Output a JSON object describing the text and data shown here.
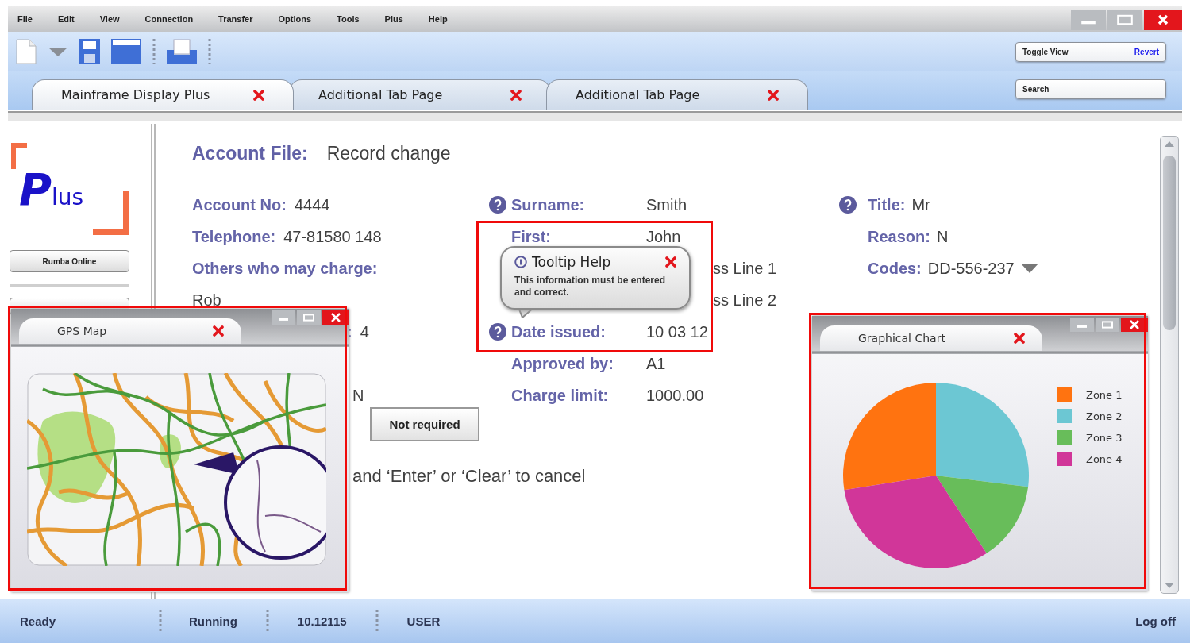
{
  "menu": [
    "File",
    "Edit",
    "View",
    "Connection",
    "Transfer",
    "Options",
    "Tools",
    "Plus",
    "Help"
  ],
  "toolbar": {
    "toggle_label": "Toggle View",
    "revert_link": "Revert",
    "search_label": "Search"
  },
  "tabs": [
    {
      "label": "Mainframe Display Plus",
      "selected": true
    },
    {
      "label": "Additional Tab Page",
      "selected": false
    },
    {
      "label": "Additional Tab Page",
      "selected": false
    }
  ],
  "sidebar": {
    "logo": "Plus",
    "buttons": [
      "Rumba Online"
    ]
  },
  "form": {
    "title_label": "Account File:",
    "title_value": "Record change",
    "columns": [
      [
        {
          "kind": "field",
          "help": false,
          "label": "Account No:",
          "value": "4444"
        },
        {
          "kind": "field",
          "help": false,
          "label": "Telephone:",
          "value": "47-81580 148"
        },
        {
          "kind": "heading",
          "help": false,
          "label": "Others who may charge:"
        },
        {
          "kind": "text",
          "help": false,
          "value": "Rob"
        },
        {
          "kind": "covered",
          "help": false,
          "label": ":",
          "value": "4"
        },
        {
          "kind": "choice",
          "help": false,
          "value": "N"
        }
      ],
      [
        {
          "kind": "field",
          "help": true,
          "label": "Surname:",
          "value": "Smith"
        },
        {
          "kind": "field",
          "help": false,
          "label": "First:",
          "value": "John"
        },
        {
          "kind": "covered",
          "help": false,
          "value": "ss Line 1"
        },
        {
          "kind": "covered",
          "help": false,
          "value": "ss Line 2"
        },
        {
          "kind": "field",
          "help": true,
          "label": "Date issued:",
          "value": "10 03 12"
        },
        {
          "kind": "field",
          "help": false,
          "label": "Approved by:",
          "value": "A1"
        },
        {
          "kind": "field",
          "help": false,
          "label": "Charge limit:",
          "value": "1000.00"
        }
      ],
      [
        {
          "kind": "inline",
          "help": true,
          "dropdown": false,
          "label": "Title:",
          "value": "Mr"
        },
        {
          "kind": "inline",
          "help": false,
          "dropdown": false,
          "label": "Reason:",
          "value": "N"
        },
        {
          "kind": "inline",
          "help": false,
          "dropdown": true,
          "label": "Codes:",
          "value": "DD-556-237"
        }
      ]
    ],
    "option_button": "Not required",
    "instruction": "and ‘Enter’ or ‘Clear’ to cancel"
  },
  "tooltip": {
    "title": "Tooltip Help",
    "text": "This information must be entered and correct."
  },
  "gps_window": {
    "title": "GPS Map"
  },
  "chart_window": {
    "title": "Graphical Chart",
    "legend": [
      {
        "label": "Zone 1",
        "color": "#ff7310"
      },
      {
        "label": "Zone 2",
        "color": "#6cc7d3"
      },
      {
        "label": "Zone 3",
        "color": "#68bd5a"
      },
      {
        "label": "Zone 4",
        "color": "#d13699"
      }
    ]
  },
  "status_bar": {
    "items": [
      "Ready",
      "Running",
      "10.12115",
      "USER"
    ],
    "logoff": "Log off"
  }
}
